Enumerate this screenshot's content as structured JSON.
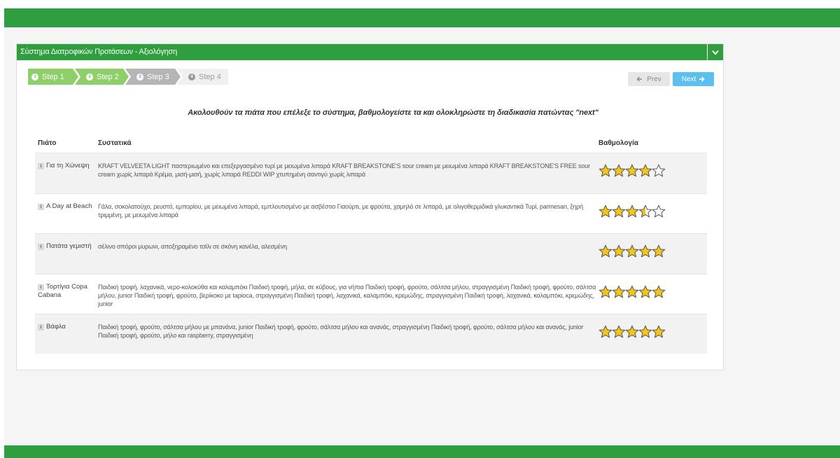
{
  "panel": {
    "title": "Σύστημα Διατροφικών Προτάσεων - Αξιολόγηση"
  },
  "wizard": {
    "steps": [
      {
        "num": "1",
        "label": "Step 1"
      },
      {
        "num": "2",
        "label": "Step 2"
      },
      {
        "num": "3",
        "label": "Step 3"
      },
      {
        "num": "4",
        "label": "Step 4"
      }
    ],
    "current_step": 3,
    "prev_label": "Prev",
    "next_label": "Next"
  },
  "instruction": "Ακολουθούν τα πιάτα που επέλεξε το σύστημα, βαθμολογείστε τα και ολοκληρώστε τη διαδικασία πατώντας \"next\"",
  "table": {
    "headers": {
      "dish": "Πιάτο",
      "ingredients": "Συστατικά",
      "rating": "Βαθμολογία"
    },
    "info_badge": "i",
    "rows": [
      {
        "dish": "Για τη Χώνεψη",
        "ingredients": "KRAFT VELVEETA LIGHT παστεριωμένο και επεξεργασμένο τυρί με μειωμένα λιπαρά KRAFT BREAKSTONE'S sour cream με μειωμένα λιπαρά KRAFT BREAKSTONE'S FREE sour cream χωρίς λιπαρά Κρέμα, μισή-μισή, χωρίς λιπαρά REDDI WIP χτυπημένη σαντιγύ χωρίς λιπαρά",
        "rating": 4
      },
      {
        "dish": "A Day at Beach",
        "ingredients": "Γάλα, σοκολατούχο, ρευστό, εμπορίου, με μειωμένα λιπαρά, εμπλουτισμένο με ασβέστιο Γιαούρτι, με φρούτα, χαμηλό σε λιπαρά, με ολιγοθερμιδικά γλυκαντικά Τυρί, parmesan, ξηρή τριμμένη, με μειωμένα λιπαρά",
        "rating": 3.5
      },
      {
        "dish": "Πατάτα γεμιστή",
        "ingredients": "σέλινο σπόροι μυρωνι, αποξηραμένο τσίλι σε σκόνη κανέλα, αλεσμένη",
        "rating": 5
      },
      {
        "dish": "Τορτίγια Copa Cabana",
        "ingredients": "Παιδική τροφή, λαχανικά, νερο-κολοκύθα και καλαμπόκι Παιδική τροφή, μήλα, σε κύβους, για νήπια Παιδική τροφή, φρούτο, σάλτσα μήλου, στραγγισμένη Παιδική τροφή, φρούτο, σάλτσα μήλου, junior Παιδική τροφή, φρούτο, βερίκοκο με tapioca, στραγγισμένη Παιδική τροφή, λαχανικά, καλαμπόκι, κρεμώδης, στραγγισμένη Παιδική τροφή, λαχανικά, καλαμπόκι, κρεμώδης, junior",
        "rating": 5
      },
      {
        "dish": "Βάφλα",
        "ingredients": "Παιδική τροφή, φρούτο, σάλτσα μήλου με μπανάνα, junior Παιδική τροφή, φρούτο, σάλτσα μήλου και ανανάς, στραγγισμένη Παιδική τροφή, φρούτο, σάλτσα μήλου και ανανάς, junior Παιδική τροφή, φρούτο, μήλο και raspberry, στραγγισμένη",
        "rating": 5
      }
    ]
  },
  "colors": {
    "brand_green": "#2e9e3e",
    "step_done": "#8fcf6a",
    "step_current": "#b5b5b5",
    "step_todo": "#f0f0f0",
    "next_button": "#5bc0f0",
    "star_fill": "#f5c518",
    "star_outline": "#555555"
  },
  "icons": {
    "collapse": "chevron-down-icon",
    "prev": "arrow-left-icon",
    "next": "arrow-right-icon",
    "rating": "star-icon"
  }
}
